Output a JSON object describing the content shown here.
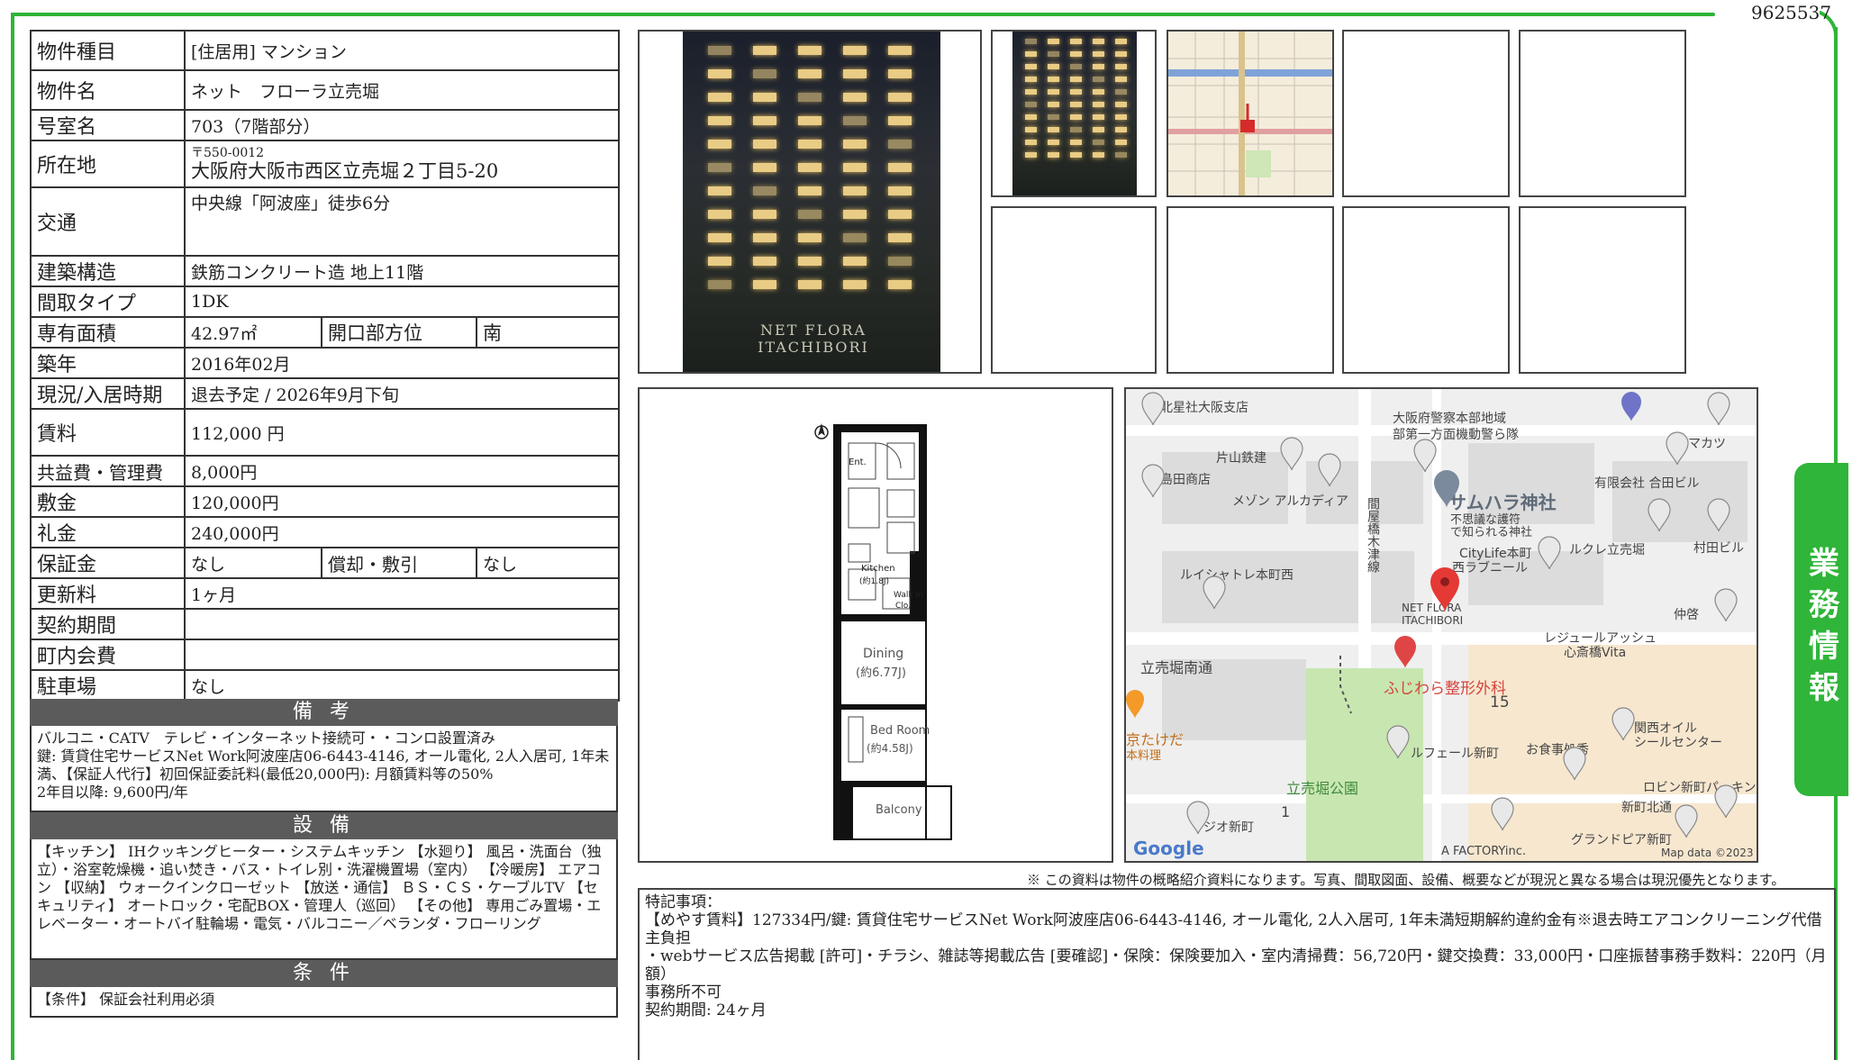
{
  "doc_id": "9625537",
  "side_tab": "業務情報",
  "property": {
    "type_label": "物件種目",
    "type_value": "[住居用] マンション",
    "name_label": "物件名",
    "name_value": "ネット　フローラ立売堀",
    "room_label": "号室名",
    "room_value": "703（7階部分）",
    "address_label": "所在地",
    "postal": "〒550-0012",
    "address_value": "大阪府大阪市西区立売堀２丁目5-20",
    "transit_label": "交通",
    "transit_value": "中央線「阿波座」徒歩6分",
    "structure_label": "建築構造",
    "structure_value": "鉄筋コンクリート造 地上11階",
    "layout_label": "間取タイプ",
    "layout_value": "1DK",
    "area_label": "専有面積",
    "area_value": "42.97㎡",
    "opening_label": "開口部方位",
    "opening_value": "南",
    "built_label": "築年",
    "built_value": "2016年02月",
    "status_label": "現況/入居時期",
    "status_value": "退去予定 / 2026年9月下旬",
    "rent_label": "賃料",
    "rent_value": "112,000 円",
    "fee_label": "共益費・管理費",
    "fee_value": "8,000円",
    "deposit_label": "敷金",
    "deposit_value": "120,000円",
    "key_money_label": "礼金",
    "key_money_value": "240,000円",
    "guarantee_label": "保証金",
    "guarantee_value": "なし",
    "amort_label": "償却・敷引",
    "amort_value": "なし",
    "renewal_label": "更新料",
    "renewal_value": "1ヶ月",
    "contract_label": "契約期間",
    "contract_value": "",
    "assoc_label": "町内会費",
    "assoc_value": "",
    "parking_label": "駐車場",
    "parking_value": "なし"
  },
  "notes": {
    "title": "備 考",
    "body": "バルコニ・CATV　テレビ・インターネット接続可・・コンロ設置済み\n鍵: 賃貸住宅サービスNet Work阿波座店06-6443-4146, オール電化, 2人入居可, 1年未満、【保証人代行】初回保証委託料(最低20,000円): 月額賃料等の50%\n2年目以降: 9,600円/年"
  },
  "equipment": {
    "title": "設 備",
    "body": "【キッチン】 IHクッキングヒーター・システムキッチン 【水廻り】 風呂・洗面台（独立）・浴室乾燥機・追い焚き・バス・トイレ別・洗濯機置場（室内） 【冷暖房】 エアコン 【収納】 ウォークインクローゼット 【放送・通信】 ＢＳ・ＣＳ・ケーブルTV 【セキュリティ】 オートロック・宅配BOX・管理人（巡回） 【その他】 専用ごみ置場・エレベーター・オートバイ駐輪場・電気・バルコニー／ベランダ・フローリング"
  },
  "conditions": {
    "title": "条 件",
    "body": "【条件】 保証会社利用必須"
  },
  "building_sign": {
    "line1": "NET FLORA",
    "line2": "ITACHIBORI"
  },
  "floorplan": {
    "rooms": {
      "entrance": "Ent.",
      "kitchen": "Kitchen",
      "kitchen_size": "(約1.8J)",
      "dining": "Dining",
      "dining_size": "(約6.77J)",
      "bedroom": "Bed Room",
      "bedroom_size": "(約4.58J)",
      "balcony": "Balcony",
      "walk_in": "Walk in",
      "closet": "Clo."
    }
  },
  "map": {
    "labels": [
      "北星社大阪支店",
      "大阪府警察本部地域",
      "部第一方面機動警ら隊",
      "ヤマカツ",
      "片山鉄建",
      "島田商店",
      "有限会社 合田ビル",
      "メゾン アルカディア",
      "サムハラ神社",
      "不思議な護符",
      "で知られる神社",
      "CityLife本町",
      "西ラブニール",
      "ルクレ立売堀",
      "村田ビル",
      "ルイシャトレ本町西",
      "間屋橋木津線",
      "NET FLORA",
      "ITACHIBORI",
      "仲啓",
      "立売堀南通",
      "ふじわら整形外科",
      "レジュールアッシュ",
      "心斎橋Vita",
      "京たけだ",
      "本料理",
      "15",
      "関西オイル",
      "シールセンター",
      "ルフェール新町",
      "お食事処秀",
      "立売堀公園",
      "ロビン新町パーキング",
      "新町北通",
      "1",
      "ジオ新町",
      "グランドピア新町",
      "A FACTORYinc.",
      "Google",
      "Map data ©2023"
    ]
  },
  "disclaimer": "※ この資料は物件の概略紹介資料になります。写真、間取図面、設備、概要などが現況と異なる場合は現況優先となります。",
  "remarks": {
    "lines": [
      "特記事項：",
      "【めやす賃料】127334円/鍵: 賃貸住宅サービスNet Work阿波座店06-6443-4146, オール電化, 2人入居可, 1年未満短期解約違約金有※退去時エアコンクリーニング代借主負担",
      "・webサービス広告掲載 [許可]・チラシ、雑誌等掲載広告 [要確認]・保険：保険要加入・室内清掃費：56,720円・鍵交換費：33,000円・口座振替事務手数料：220円（月額）",
      "事務所不可",
      "契約期間: 24ヶ月"
    ]
  },
  "colors": {
    "frame_green": "#2fb539",
    "section_gray": "#5b5b5b",
    "pin_red": "#e53935"
  }
}
